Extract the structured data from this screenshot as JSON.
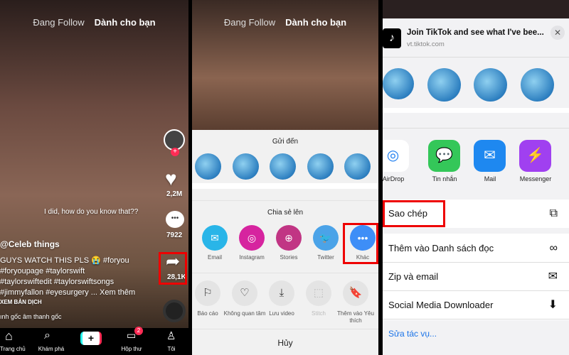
{
  "panel1": {
    "tabs": {
      "following": "Đang Follow",
      "for_you": "Dành cho bạn"
    },
    "caption_overlay": "I did, how do you know that??",
    "username": "@Celeb things",
    "description": [
      "GUYS WATCH THIS PLS 😭 #foryou",
      "#foryoupage #taylorswift",
      "#taylorswiftedit #taylorswiftsongs",
      "#jimmyfallon #eyesurgery ... Xem thêm"
    ],
    "translate": "XEM BẢN DỊCH",
    "sound": "ınh gốc   âm thanh gốc",
    "likes": "2,2M",
    "comments": "7922",
    "shares": "28,1K",
    "nav": [
      "Trang chủ",
      "Khám phá",
      "",
      "Hộp thư",
      "Tôi"
    ],
    "inbox_badge": "2"
  },
  "panel2": {
    "tabs": {
      "following": "Đang Follow",
      "for_you": "Dành cho bạn"
    },
    "send_to_title": "Gửi đến",
    "share_to_title": "Chia sẻ lên",
    "share_apps": [
      {
        "label": "Email",
        "color": "#29b5e8",
        "icon": "✉"
      },
      {
        "label": "Instagram",
        "color": "#d6249f",
        "icon": "◎"
      },
      {
        "label": "Stories",
        "color": "#c13584",
        "icon": "⊕"
      },
      {
        "label": "Twitter",
        "color": "#4ba3e8",
        "icon": "🐦"
      },
      {
        "label": "Khác",
        "color": "#3e8ef7",
        "icon": "•••"
      }
    ],
    "actions": [
      {
        "label": "Báo cáo",
        "icon": "⚐"
      },
      {
        "label": "Không quan tâm",
        "icon": "♡"
      },
      {
        "label": "Lưu video",
        "icon": "⤓"
      },
      {
        "label": "Stitch",
        "icon": "⬚"
      },
      {
        "label": "Thêm vào Yêu thích",
        "icon": "🔖"
      }
    ],
    "cancel": "Hủy"
  },
  "panel3": {
    "link_title": "Join TikTok and see what I've bee...",
    "link_domain": "vt.tiktok.com",
    "apps": [
      {
        "label": "AirDrop",
        "color": "#ffffff",
        "icon": "◎"
      },
      {
        "label": "Tin nhắn",
        "color": "#34c759",
        "icon": "💬"
      },
      {
        "label": "Mail",
        "color": "#1e88f0",
        "icon": "✉"
      },
      {
        "label": "Messenger",
        "color": "#a040f0",
        "icon": "⚡"
      }
    ],
    "actions": [
      {
        "label": "Sao chép",
        "icon": "⧉"
      },
      {
        "label": "Thêm vào Danh sách đọc",
        "icon": "∞"
      },
      {
        "label": "Zip và email",
        "icon": "✉"
      },
      {
        "label": "Social Media Downloader",
        "icon": "⬇"
      }
    ],
    "edit_actions": "Sửa tác vụ..."
  }
}
